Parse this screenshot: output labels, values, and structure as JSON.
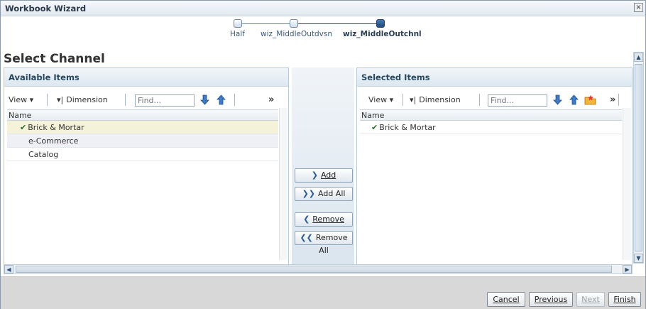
{
  "window": {
    "title": "Workbook Wizard",
    "close_glyph": "×"
  },
  "train": {
    "steps": [
      {
        "label": "Half",
        "state": "visited"
      },
      {
        "label": "wiz_MiddleOutdvsn",
        "state": "visited"
      },
      {
        "label": "wiz_MiddleOutchnl",
        "state": "current"
      }
    ]
  },
  "page_title": "Select Channel",
  "available": {
    "header": "Available Items",
    "toolbar": {
      "view_label": "View",
      "dimension_label": "Dimension",
      "find_placeholder": "Find...",
      "overflow": "»"
    },
    "column_header": "Name",
    "rows": [
      {
        "label": "Brick & Mortar",
        "checked": true
      },
      {
        "label": "e-Commerce",
        "checked": false
      },
      {
        "label": "Catalog",
        "checked": false
      }
    ]
  },
  "selected": {
    "header": "Selected Items",
    "toolbar": {
      "view_label": "View",
      "dimension_label": "Dimension",
      "find_placeholder": "Find...",
      "overflow": "»"
    },
    "column_header": "Name",
    "rows": [
      {
        "label": "Brick & Mortar",
        "checked": true
      }
    ]
  },
  "shuttle": {
    "add": "Add",
    "add_all": "Add All",
    "remove": "Remove",
    "remove_all": "Remove All"
  },
  "footer": {
    "cancel": "Cancel",
    "previous": "Previous",
    "next": "Next",
    "finish": "Finish"
  },
  "icons": {
    "check": "check-icon",
    "move_down": "arrow-down-icon",
    "move_up": "arrow-up-icon",
    "folder": "folder-icon"
  },
  "colors": {
    "accent": "#274761",
    "selected_row": "#f4f3d9",
    "current_step": "#1f4a7a"
  }
}
